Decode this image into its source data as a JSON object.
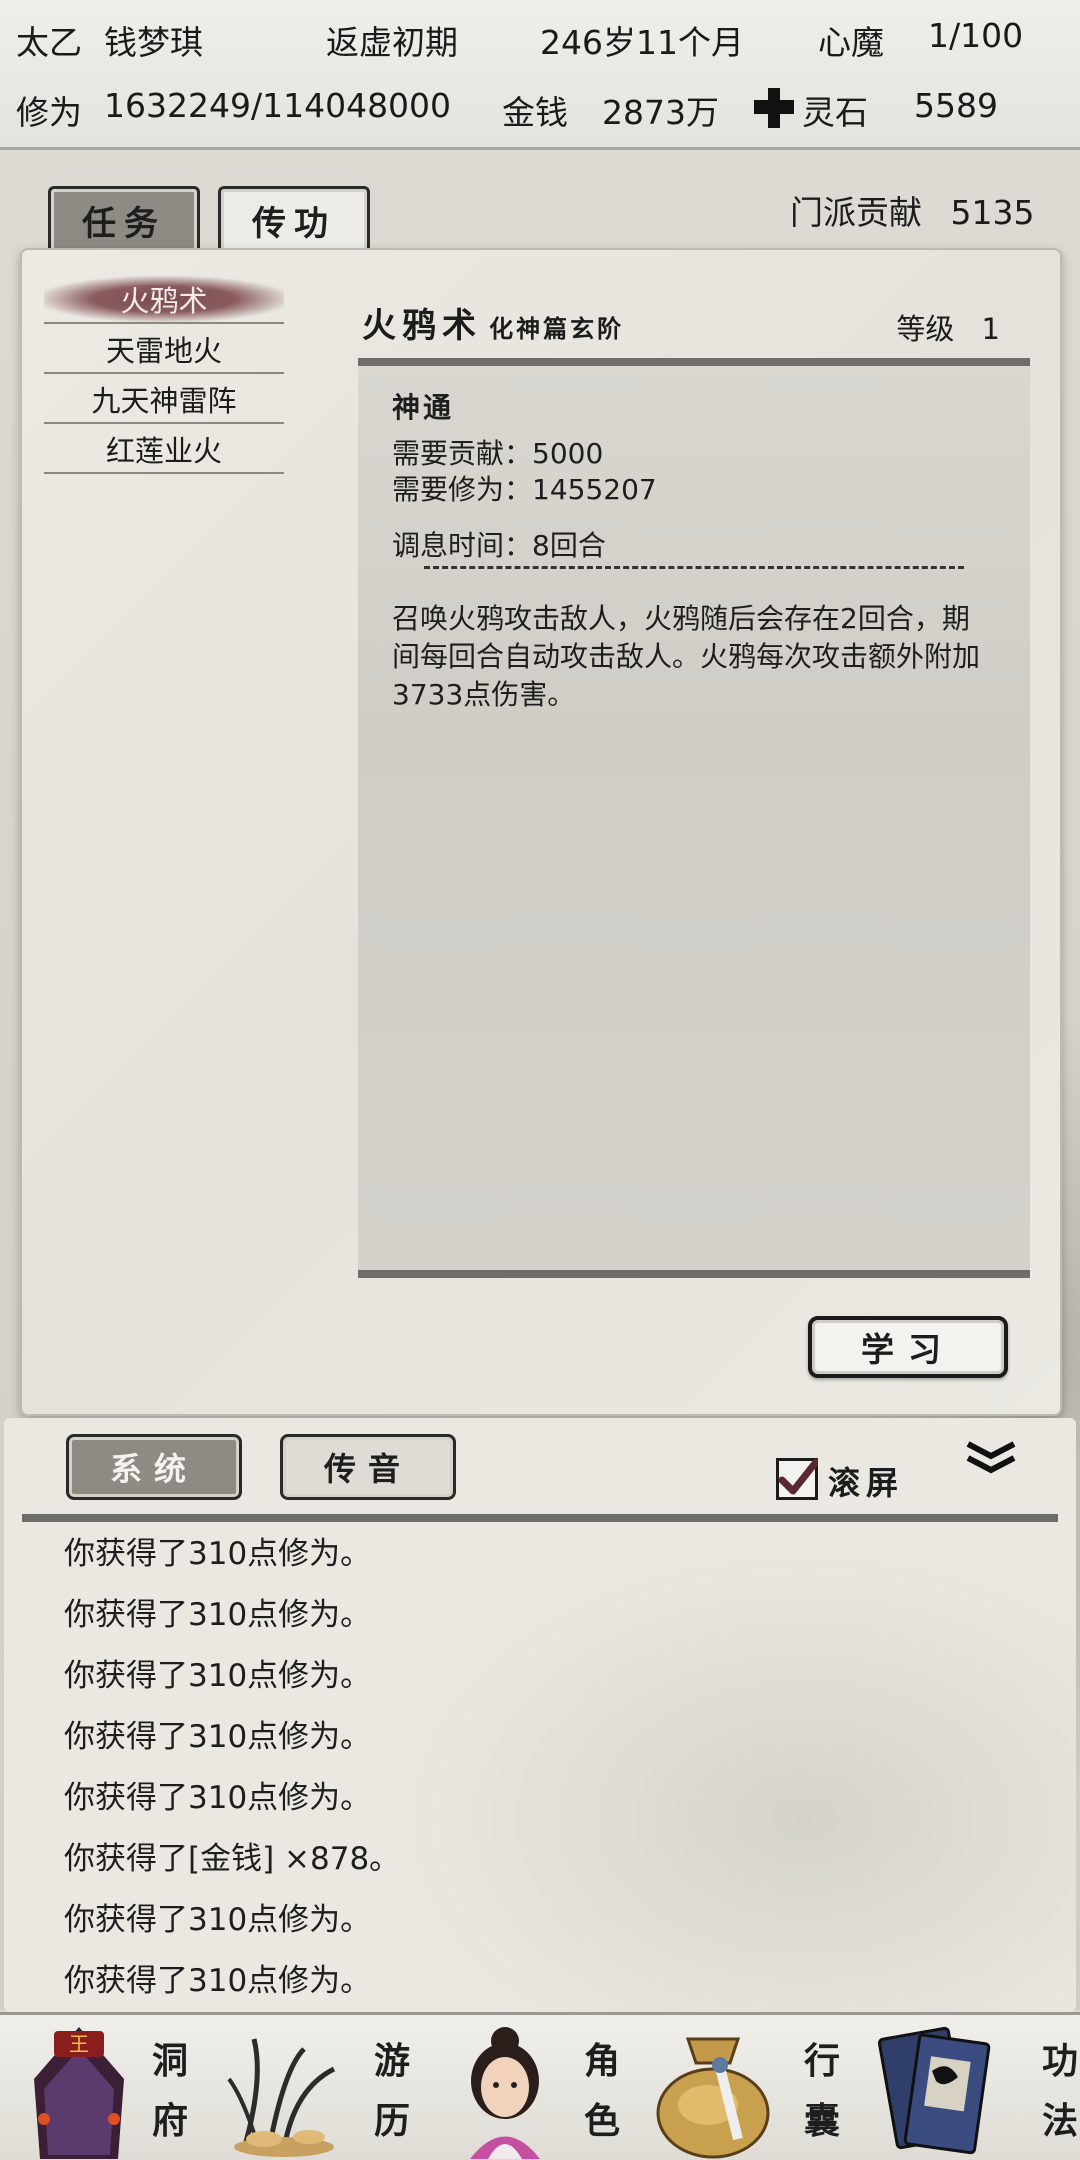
{
  "status": {
    "sect": "太乙",
    "name": "钱梦琪",
    "realm": "返虚初期",
    "age": "246岁11个月",
    "heart_demon_label": "心魔",
    "heart_demon_value": "1/100",
    "cultivation_label": "修为",
    "cultivation_value": "1632249/114048000",
    "money_label": "金钱",
    "money_value": "2873万",
    "spirit_stone_label": "灵石",
    "spirit_stone_value": "5589"
  },
  "tabs": {
    "tasks": "任务",
    "skills": "传功"
  },
  "sect_contribution": {
    "label": "门派贡献",
    "value": "5135"
  },
  "skill_list": [
    "火鸦术",
    "天雷地火",
    "九天神雷阵",
    "红莲业火"
  ],
  "skill_detail": {
    "name": "火鸦术",
    "tier": "化神篇玄阶",
    "level_label": "等级",
    "level_value": "1",
    "type": "神通",
    "req_contribution": "需要贡献：5000",
    "req_cultivation": "需要修为：1455207",
    "cooldown": "调息时间：8回合",
    "description": "召唤火鸦攻击敌人，火鸦随后会存在2回合，期间每回合自动攻击敌人。火鸦每次攻击额外附加3733点伤害。"
  },
  "learn_button": "学习",
  "log": {
    "tab_system": "系统",
    "tab_chat": "传音",
    "auto_scroll_label": "滚屏",
    "auto_scroll_checked": true,
    "lines": [
      "你获得了310点修为。",
      "你获得了310点修为。",
      "你获得了310点修为。",
      "你获得了310点修为。",
      "你获得了310点修为。",
      "你获得了[金钱] ×878。",
      "你获得了310点修为。",
      "你获得了310点修为。"
    ]
  },
  "bottom_nav": [
    {
      "icon": "cave-dwelling-icon",
      "label_top": "洞",
      "label_bottom": "府"
    },
    {
      "icon": "travel-grass-icon",
      "label_top": "游",
      "label_bottom": "历"
    },
    {
      "icon": "character-portrait-icon",
      "label_top": "角",
      "label_bottom": "色"
    },
    {
      "icon": "bag-icon",
      "label_top": "行",
      "label_bottom": "囊"
    },
    {
      "icon": "scroll-books-icon",
      "label_top": "功",
      "label_bottom": "法"
    }
  ]
}
